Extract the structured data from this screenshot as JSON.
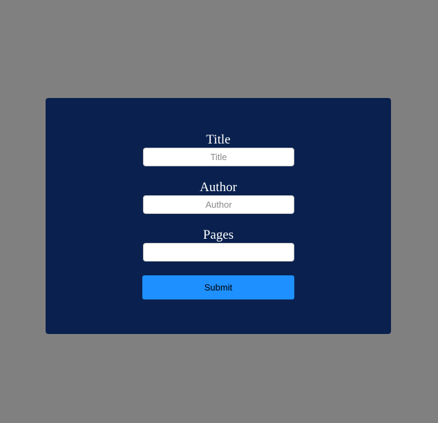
{
  "form": {
    "title_label": "Title",
    "title_placeholder": "Title",
    "title_value": "",
    "author_label": "Author",
    "author_placeholder": "Author",
    "author_value": "",
    "pages_label": "Pages",
    "pages_placeholder": "",
    "pages_value": "",
    "submit_label": "Submit"
  },
  "colors": {
    "backdrop": "#808080",
    "modal_background": "#0a214f",
    "submit_button": "#1e90ff",
    "label_text": "#ffffff"
  }
}
